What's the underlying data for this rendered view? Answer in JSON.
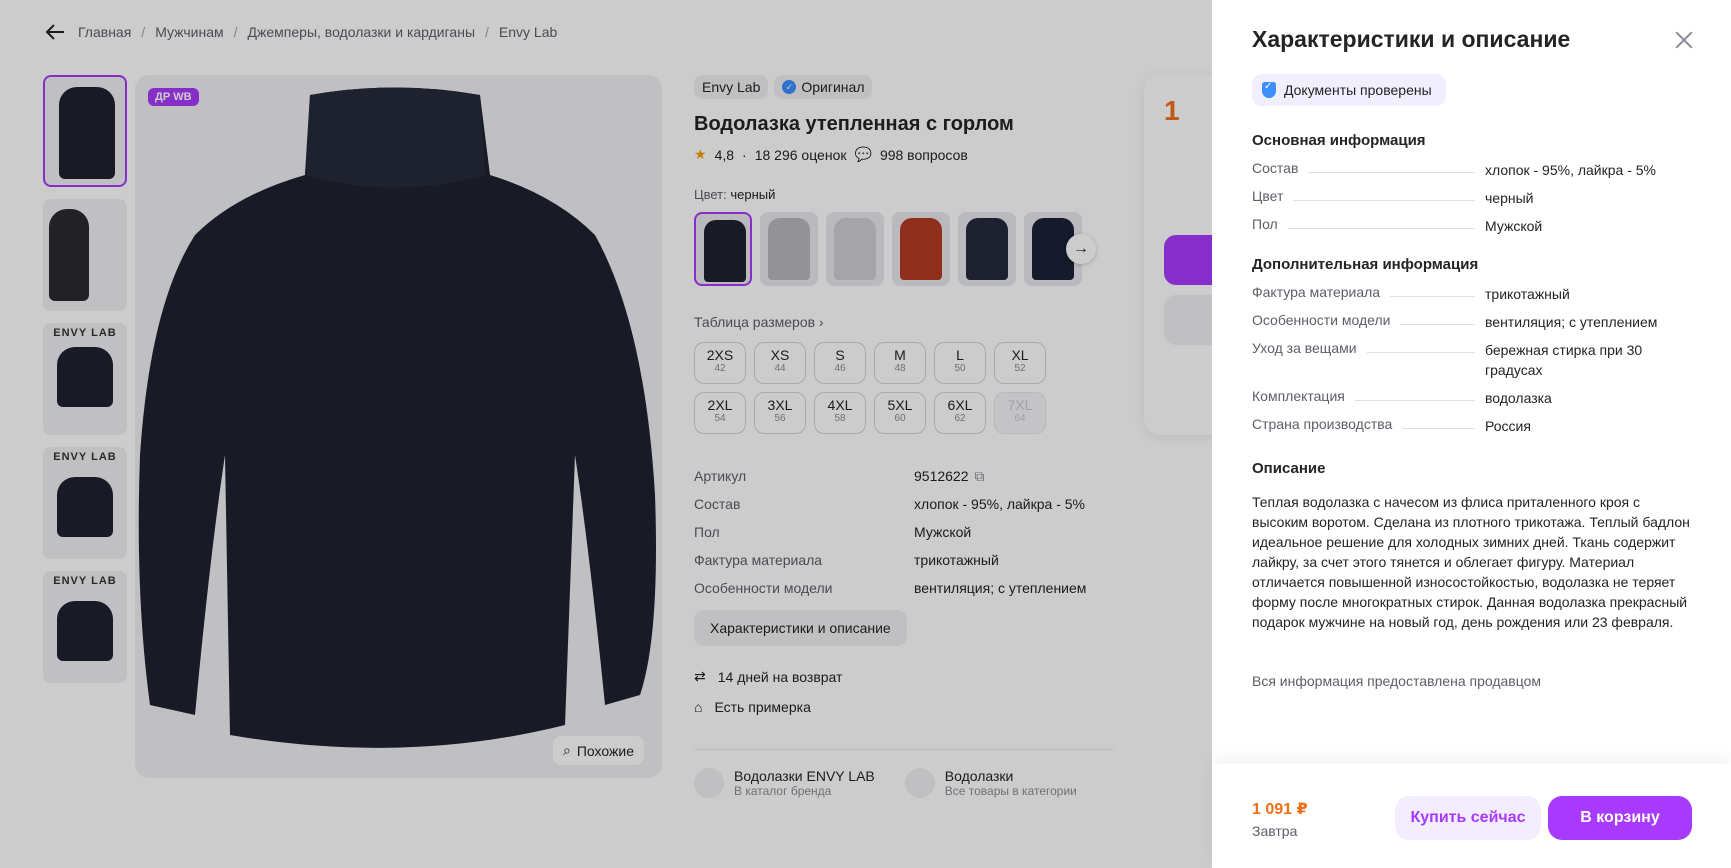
{
  "breadcrumb": [
    "Главная",
    "Мужчинам",
    "Джемперы, водолазки и кардиганы",
    "Envy Lab"
  ],
  "gallery": {
    "badge": "ДР WB",
    "thumb_captions": [
      "",
      "",
      "ENVY LAB",
      "ENVY LAB",
      "ENVY LAB"
    ],
    "similar_label": "Похожие"
  },
  "product": {
    "brand": "Envy Lab",
    "original_label": "Оригинал",
    "title": "Водолазка утепленная с горлом",
    "rating": "4,8",
    "reviews": "18 296 оценок",
    "questions": "998 вопросов",
    "color_label": "Цвет:",
    "color_value": "черный",
    "size_table_link": "Таблица размеров",
    "sizes": [
      {
        "label": "2XS",
        "ru": "42"
      },
      {
        "label": "XS",
        "ru": "44"
      },
      {
        "label": "S",
        "ru": "46"
      },
      {
        "label": "M",
        "ru": "48"
      },
      {
        "label": "L",
        "ru": "50"
      },
      {
        "label": "XL",
        "ru": "52"
      },
      {
        "label": "2XL",
        "ru": "54"
      },
      {
        "label": "3XL",
        "ru": "56"
      },
      {
        "label": "4XL",
        "ru": "58"
      },
      {
        "label": "5XL",
        "ru": "60"
      },
      {
        "label": "6XL",
        "ru": "62"
      },
      {
        "label": "7XL",
        "ru": "64"
      }
    ],
    "specs": [
      {
        "k": "Артикул",
        "v": "9512622"
      },
      {
        "k": "Состав",
        "v": "хлопок - 95%, лайкра - 5%"
      },
      {
        "k": "Пол",
        "v": "Мужской"
      },
      {
        "k": "Фактура материала",
        "v": "трикотажный"
      },
      {
        "k": "Особенности модели",
        "v": "вентиляция; с утеплением"
      }
    ],
    "char_button": "Характеристики и описание",
    "return_text": "14 дней на возврат",
    "fitting_text": "Есть примерка",
    "links": [
      {
        "t1": "Водолазки ENVY LAB",
        "t2": "В каталог бренда"
      },
      {
        "t1": "Водолазки",
        "t2": "Все товары в категории"
      }
    ]
  },
  "side_card": {
    "price_partial": "1"
  },
  "drawer": {
    "title": "Характеристики и описание",
    "docs_verified": "Документы проверены",
    "main_heading": "Основная информация",
    "main_rows": [
      {
        "k": "Состав",
        "v": "хлопок - 95%, лайкра - 5%"
      },
      {
        "k": "Цвет",
        "v": "черный"
      },
      {
        "k": "Пол",
        "v": "Мужской"
      }
    ],
    "extra_heading": "Дополнительная информация",
    "extra_rows": [
      {
        "k": "Фактура материала",
        "v": "трикотажный"
      },
      {
        "k": "Особенности модели",
        "v": "вентиляция; с утеплением"
      },
      {
        "k": "Уход за вещами",
        "v": "бережная стирка при 30 градусах"
      },
      {
        "k": "Комплектация",
        "v": "водолазка"
      },
      {
        "k": "Страна производства",
        "v": "Россия"
      }
    ],
    "desc_heading": "Описание",
    "description": "Теплая водолазка с начесом из флиса приталенного кроя с высоким воротом. Сделана из плотного трикотажа. Теплый бадлон идеальное решение для холодных зимних дней. Ткань содержит лайкру, за счет этого тянется и облегает фигуру. Материал отличается повышенной износостойкостью, водолазка не теряет форму после многократных стирок. Данная водолазка прекрасный подарок мужчине на новый год, день рождения или 23 февраля.",
    "seller_note": "Вся информация предоставлена продавцом",
    "footer": {
      "price": "1 091 ₽",
      "delivery": "Завтра",
      "buy_now": "Купить сейчас",
      "to_cart": "В корзину"
    }
  },
  "colors": {
    "accent": "#a73afd",
    "price": "#f26f18",
    "swatches": [
      "#1e2130",
      "#b8b8bd",
      "#cfcfd2",
      "#b53a24",
      "#252a3c",
      "#1c2236"
    ]
  }
}
